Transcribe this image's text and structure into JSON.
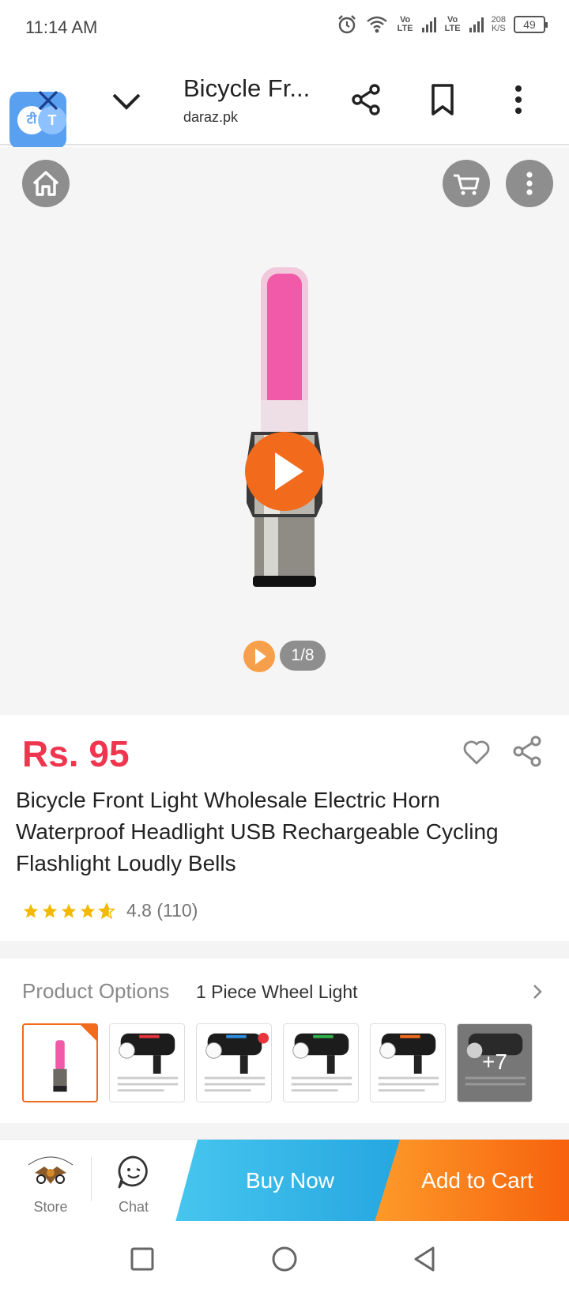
{
  "status_bar": {
    "time": "11:14 AM",
    "lte1": "Vo LTE",
    "lte2": "Vo LTE",
    "speed_value": "208",
    "speed_unit": "K/S",
    "battery": "49"
  },
  "browser": {
    "title": "Bicycle Fr...",
    "domain": "daraz.pk",
    "translate_glyph_1": "टी",
    "translate_glyph_2": "T"
  },
  "media": {
    "counter": "1/8"
  },
  "product": {
    "price": "Rs. 95",
    "title": "Bicycle Front Light Wholesale Electric Horn Waterproof Headlight USB Rechargeable Cycling Flashlight Loudly Bells",
    "rating_value": "4.8",
    "rating_count": "(110)",
    "rating_text": "4.8 (110)",
    "stars": 4.8
  },
  "options": {
    "label": "Product Options",
    "value": "1 Piece Wheel Light",
    "more_label": "+7",
    "thumb_accent_colors": [
      "#e8353d",
      "#2f8fe0",
      "#2fb34a",
      "#f26a1b"
    ]
  },
  "actions": {
    "store_label": "Store",
    "store_logo_text": "FLY ON WHEELS",
    "chat_label": "Chat",
    "buy_now": "Buy Now",
    "add_to_cart": "Add to Cart"
  },
  "colors": {
    "price": "#f0354f",
    "accent_orange": "#f26a1b",
    "buy_now": "#2ab0e6",
    "add_to_cart": "#f7620d"
  }
}
